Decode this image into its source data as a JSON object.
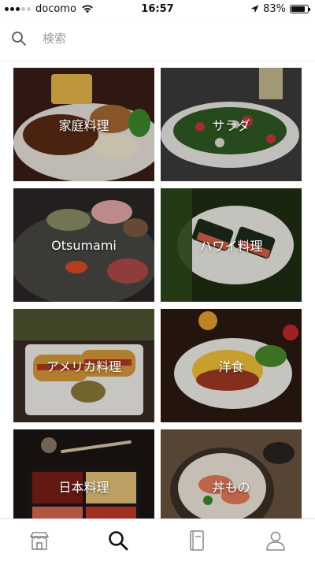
{
  "status_bar": {
    "carrier": "docomo",
    "time": "16:57",
    "battery": "83%",
    "battery_level": 0.83
  },
  "search": {
    "placeholder": "検索"
  },
  "categories": [
    {
      "label": "家庭料理"
    },
    {
      "label": "サラダ"
    },
    {
      "label": "Otsumami"
    },
    {
      "label": "ハワイ料理"
    },
    {
      "label": "アメリカ料理"
    },
    {
      "label": "洋食"
    },
    {
      "label": "日本料理"
    },
    {
      "label": "丼もの"
    }
  ],
  "tab_bar": {
    "items": [
      {
        "icon": "store-icon",
        "active": false
      },
      {
        "icon": "search-icon",
        "active": true
      },
      {
        "icon": "book-icon",
        "active": false
      },
      {
        "icon": "profile-icon",
        "active": false
      }
    ]
  }
}
